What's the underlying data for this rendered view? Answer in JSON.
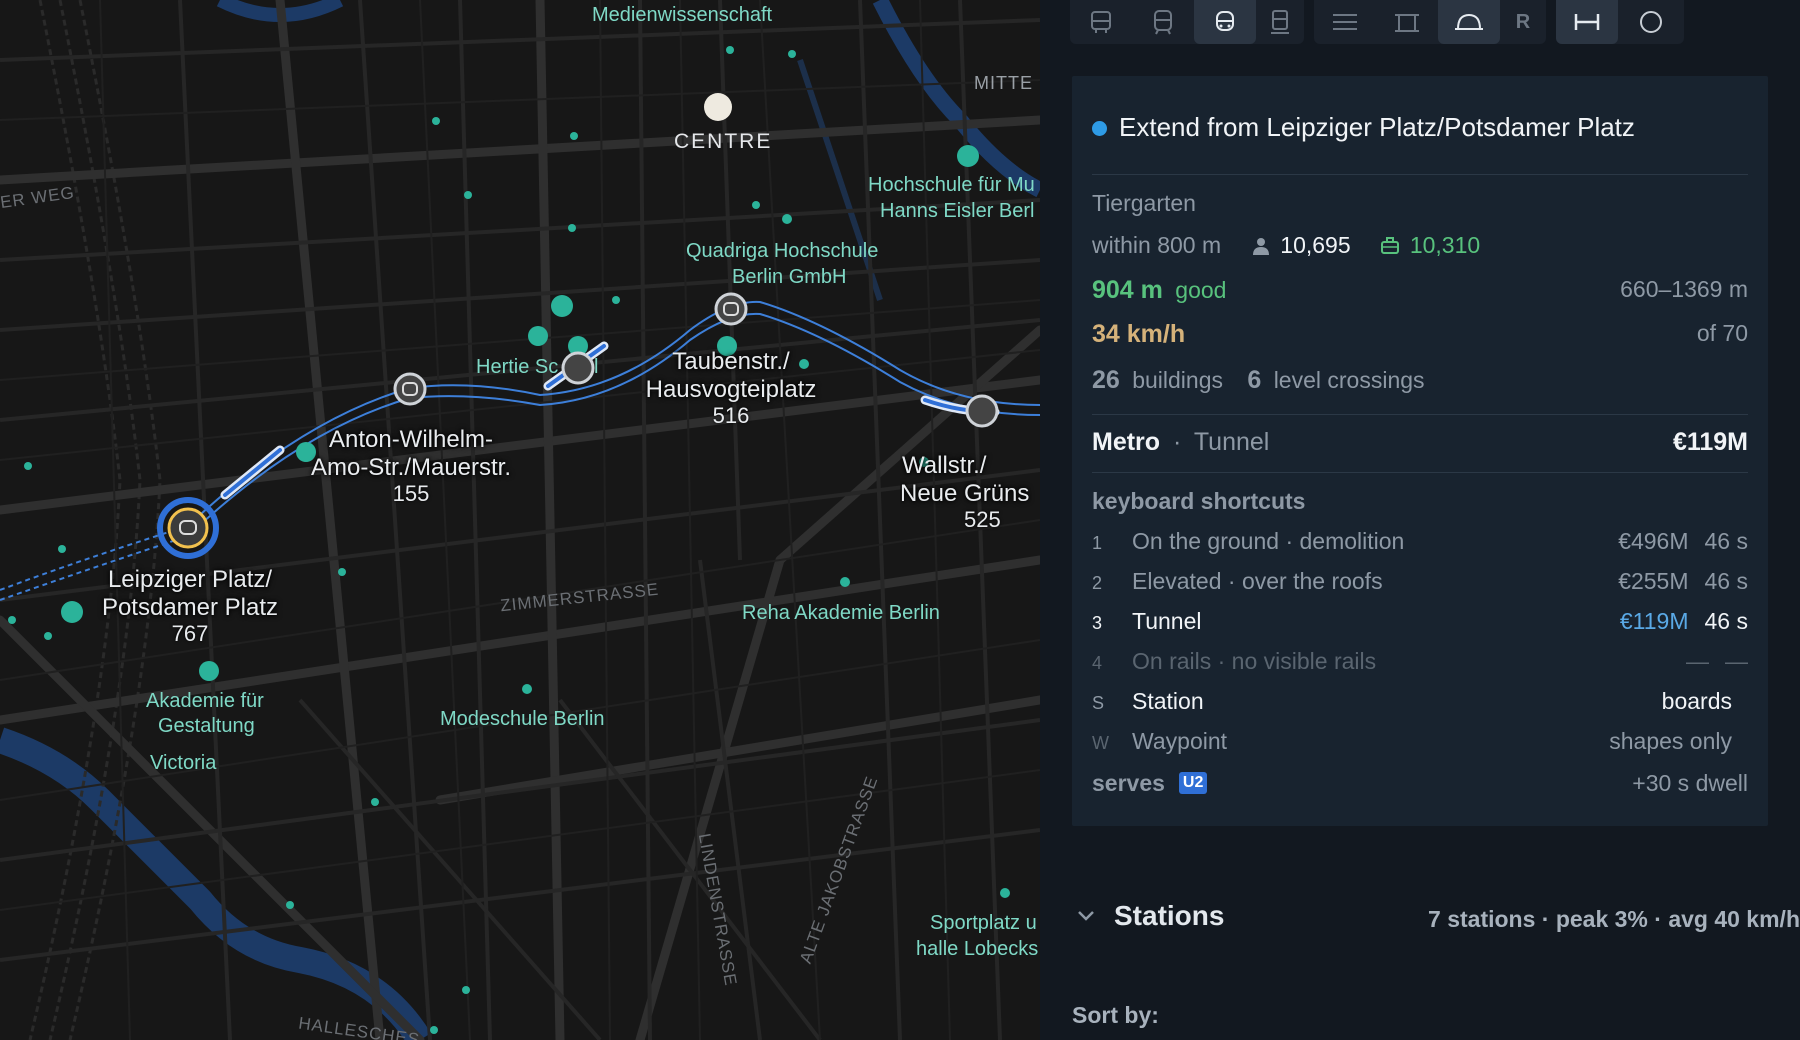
{
  "map": {
    "districts": [
      "MITTE"
    ],
    "centre_label": "CENTRE",
    "streets": [
      "ER WEG",
      "ZIMMERSTRASSE",
      "LINDENSTRASSE",
      "ALTE JAKOBSTRASSE",
      "HALLESCHES"
    ],
    "pois": [
      "Medienwissenschaft",
      "Hochschule für Mu",
      "Hanns Eisler Berl",
      "Quadriga Hochschule",
      "Berlin GmbH",
      "Hertie Sc",
      "l",
      "Reha Akademie Berlin",
      "Modeschule Berlin",
      "Akademie für",
      "Gestaltung",
      "Victoria",
      "Sportplatz u",
      "halle Lobecks"
    ],
    "stations": [
      {
        "line1": "Leipziger Platz/",
        "line2": "Potsdamer Platz",
        "count": "767"
      },
      {
        "line1": "Anton-Wilhelm-",
        "line2": "Amo-Str./Mauerstr.",
        "count": "155"
      },
      {
        "line1": "Taubenstr./",
        "line2": "Hausvogteiplatz",
        "count": "516"
      },
      {
        "line1": "Wallstr./",
        "line2": "Neue Grüns",
        "count": "525"
      }
    ]
  },
  "toolbar": {
    "buttons": [
      {
        "icon": "bus-icon",
        "active": false
      },
      {
        "icon": "tram-icon",
        "active": false
      },
      {
        "icon": "metro-icon",
        "active": true
      },
      {
        "icon": "train-icon",
        "active": false
      },
      {
        "icon": "at-grade-icon",
        "active": false
      },
      {
        "icon": "elevated-icon",
        "active": false
      },
      {
        "icon": "tunnel-icon",
        "active": true
      },
      {
        "icon": "rails-icon",
        "label": "R",
        "active": false
      },
      {
        "icon": "segment-icon",
        "active": true
      },
      {
        "icon": "circle-icon",
        "active": false
      }
    ]
  },
  "card": {
    "title": "Extend from Leipziger Platz/Potsdamer Platz",
    "title_dot_color": "#2e9be6",
    "area": "Tiergarten",
    "within": "within 800 m",
    "population": "10,695",
    "jobs": "10,310",
    "spacing": "904 m",
    "spacing_quality": "good",
    "spacing_range": "660–1369 m",
    "speed": "34 km/h",
    "speed_of": "of 70",
    "buildings_count": "26",
    "buildings_label": "buildings",
    "crossings_count": "6",
    "crossings_label": "level crossings",
    "mode": "Metro",
    "separator": "·",
    "construction": "Tunnel",
    "cost": "€119M",
    "shortcuts_title": "keyboard shortcuts",
    "shortcuts": [
      {
        "key": "1",
        "label": "On the ground · demolition",
        "cost": "€496M",
        "time": "46 s"
      },
      {
        "key": "2",
        "label": "Elevated · over the roofs",
        "cost": "€255M",
        "time": "46 s"
      },
      {
        "key": "3",
        "label": "Tunnel",
        "cost": "€119M",
        "time": "46 s"
      },
      {
        "key": "4",
        "label": "On rails · no visible rails",
        "cost": "—",
        "time": "—"
      },
      {
        "key": "S",
        "label": "Station",
        "value": "boards"
      },
      {
        "key": "W",
        "label": "Waypoint",
        "value": "shapes only"
      }
    ],
    "serves_label": "serves",
    "serves_line": "U2",
    "dwell": "+30 s dwell"
  },
  "stations_section": {
    "title": "Stations",
    "summary": "7 stations · peak 3% · avg 40 km/h"
  },
  "sort_by": "Sort by:"
}
